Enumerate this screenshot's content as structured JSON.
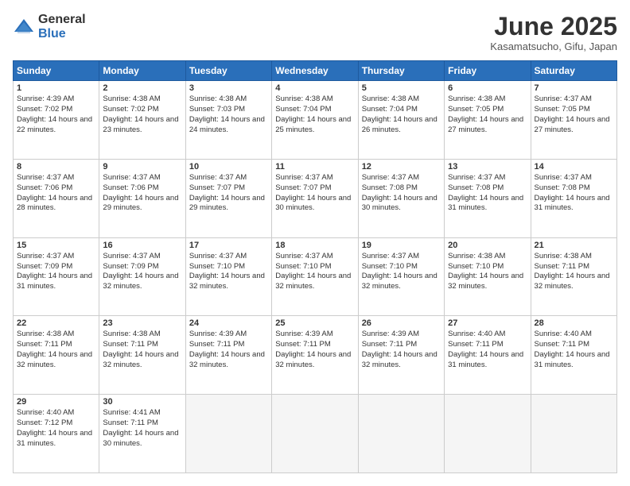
{
  "header": {
    "logo_general": "General",
    "logo_blue": "Blue",
    "month_title": "June 2025",
    "location": "Kasamatsucho, Gifu, Japan"
  },
  "calendar": {
    "days_of_week": [
      "Sunday",
      "Monday",
      "Tuesday",
      "Wednesday",
      "Thursday",
      "Friday",
      "Saturday"
    ],
    "weeks": [
      [
        {
          "day": "",
          "empty": true
        },
        {
          "day": "2",
          "sunrise": "4:38 AM",
          "sunset": "7:02 PM",
          "daylight": "14 hours and 23 minutes."
        },
        {
          "day": "3",
          "sunrise": "4:38 AM",
          "sunset": "7:03 PM",
          "daylight": "14 hours and 24 minutes."
        },
        {
          "day": "4",
          "sunrise": "4:38 AM",
          "sunset": "7:04 PM",
          "daylight": "14 hours and 25 minutes."
        },
        {
          "day": "5",
          "sunrise": "4:38 AM",
          "sunset": "7:04 PM",
          "daylight": "14 hours and 26 minutes."
        },
        {
          "day": "6",
          "sunrise": "4:38 AM",
          "sunset": "7:05 PM",
          "daylight": "14 hours and 27 minutes."
        },
        {
          "day": "7",
          "sunrise": "4:37 AM",
          "sunset": "7:05 PM",
          "daylight": "14 hours and 27 minutes."
        }
      ],
      [
        {
          "day": "1",
          "sunrise": "4:39 AM",
          "sunset": "7:02 PM",
          "daylight": "14 hours and 22 minutes."
        },
        {
          "day": "9",
          "sunrise": "4:37 AM",
          "sunset": "7:06 PM",
          "daylight": "14 hours and 29 minutes."
        },
        {
          "day": "10",
          "sunrise": "4:37 AM",
          "sunset": "7:07 PM",
          "daylight": "14 hours and 29 minutes."
        },
        {
          "day": "11",
          "sunrise": "4:37 AM",
          "sunset": "7:07 PM",
          "daylight": "14 hours and 30 minutes."
        },
        {
          "day": "12",
          "sunrise": "4:37 AM",
          "sunset": "7:08 PM",
          "daylight": "14 hours and 30 minutes."
        },
        {
          "day": "13",
          "sunrise": "4:37 AM",
          "sunset": "7:08 PM",
          "daylight": "14 hours and 31 minutes."
        },
        {
          "day": "14",
          "sunrise": "4:37 AM",
          "sunset": "7:08 PM",
          "daylight": "14 hours and 31 minutes."
        }
      ],
      [
        {
          "day": "8",
          "sunrise": "4:37 AM",
          "sunset": "7:06 PM",
          "daylight": "14 hours and 28 minutes."
        },
        {
          "day": "16",
          "sunrise": "4:37 AM",
          "sunset": "7:09 PM",
          "daylight": "14 hours and 32 minutes."
        },
        {
          "day": "17",
          "sunrise": "4:37 AM",
          "sunset": "7:10 PM",
          "daylight": "14 hours and 32 minutes."
        },
        {
          "day": "18",
          "sunrise": "4:37 AM",
          "sunset": "7:10 PM",
          "daylight": "14 hours and 32 minutes."
        },
        {
          "day": "19",
          "sunrise": "4:37 AM",
          "sunset": "7:10 PM",
          "daylight": "14 hours and 32 minutes."
        },
        {
          "day": "20",
          "sunrise": "4:38 AM",
          "sunset": "7:10 PM",
          "daylight": "14 hours and 32 minutes."
        },
        {
          "day": "21",
          "sunrise": "4:38 AM",
          "sunset": "7:11 PM",
          "daylight": "14 hours and 32 minutes."
        }
      ],
      [
        {
          "day": "15",
          "sunrise": "4:37 AM",
          "sunset": "7:09 PM",
          "daylight": "14 hours and 31 minutes."
        },
        {
          "day": "23",
          "sunrise": "4:38 AM",
          "sunset": "7:11 PM",
          "daylight": "14 hours and 32 minutes."
        },
        {
          "day": "24",
          "sunrise": "4:39 AM",
          "sunset": "7:11 PM",
          "daylight": "14 hours and 32 minutes."
        },
        {
          "day": "25",
          "sunrise": "4:39 AM",
          "sunset": "7:11 PM",
          "daylight": "14 hours and 32 minutes."
        },
        {
          "day": "26",
          "sunrise": "4:39 AM",
          "sunset": "7:11 PM",
          "daylight": "14 hours and 32 minutes."
        },
        {
          "day": "27",
          "sunrise": "4:40 AM",
          "sunset": "7:11 PM",
          "daylight": "14 hours and 31 minutes."
        },
        {
          "day": "28",
          "sunrise": "4:40 AM",
          "sunset": "7:11 PM",
          "daylight": "14 hours and 31 minutes."
        }
      ],
      [
        {
          "day": "22",
          "sunrise": "4:38 AM",
          "sunset": "7:11 PM",
          "daylight": "14 hours and 32 minutes."
        },
        {
          "day": "30",
          "sunrise": "4:41 AM",
          "sunset": "7:11 PM",
          "daylight": "14 hours and 30 minutes."
        },
        {
          "day": "",
          "empty": true
        },
        {
          "day": "",
          "empty": true
        },
        {
          "day": "",
          "empty": true
        },
        {
          "day": "",
          "empty": true
        },
        {
          "day": "",
          "empty": true
        }
      ],
      [
        {
          "day": "29",
          "sunrise": "4:40 AM",
          "sunset": "7:12 PM",
          "daylight": "14 hours and 31 minutes."
        },
        {
          "day": "",
          "empty": true
        },
        {
          "day": "",
          "empty": true
        },
        {
          "day": "",
          "empty": true
        },
        {
          "day": "",
          "empty": true
        },
        {
          "day": "",
          "empty": true
        },
        {
          "day": "",
          "empty": true
        }
      ]
    ]
  }
}
